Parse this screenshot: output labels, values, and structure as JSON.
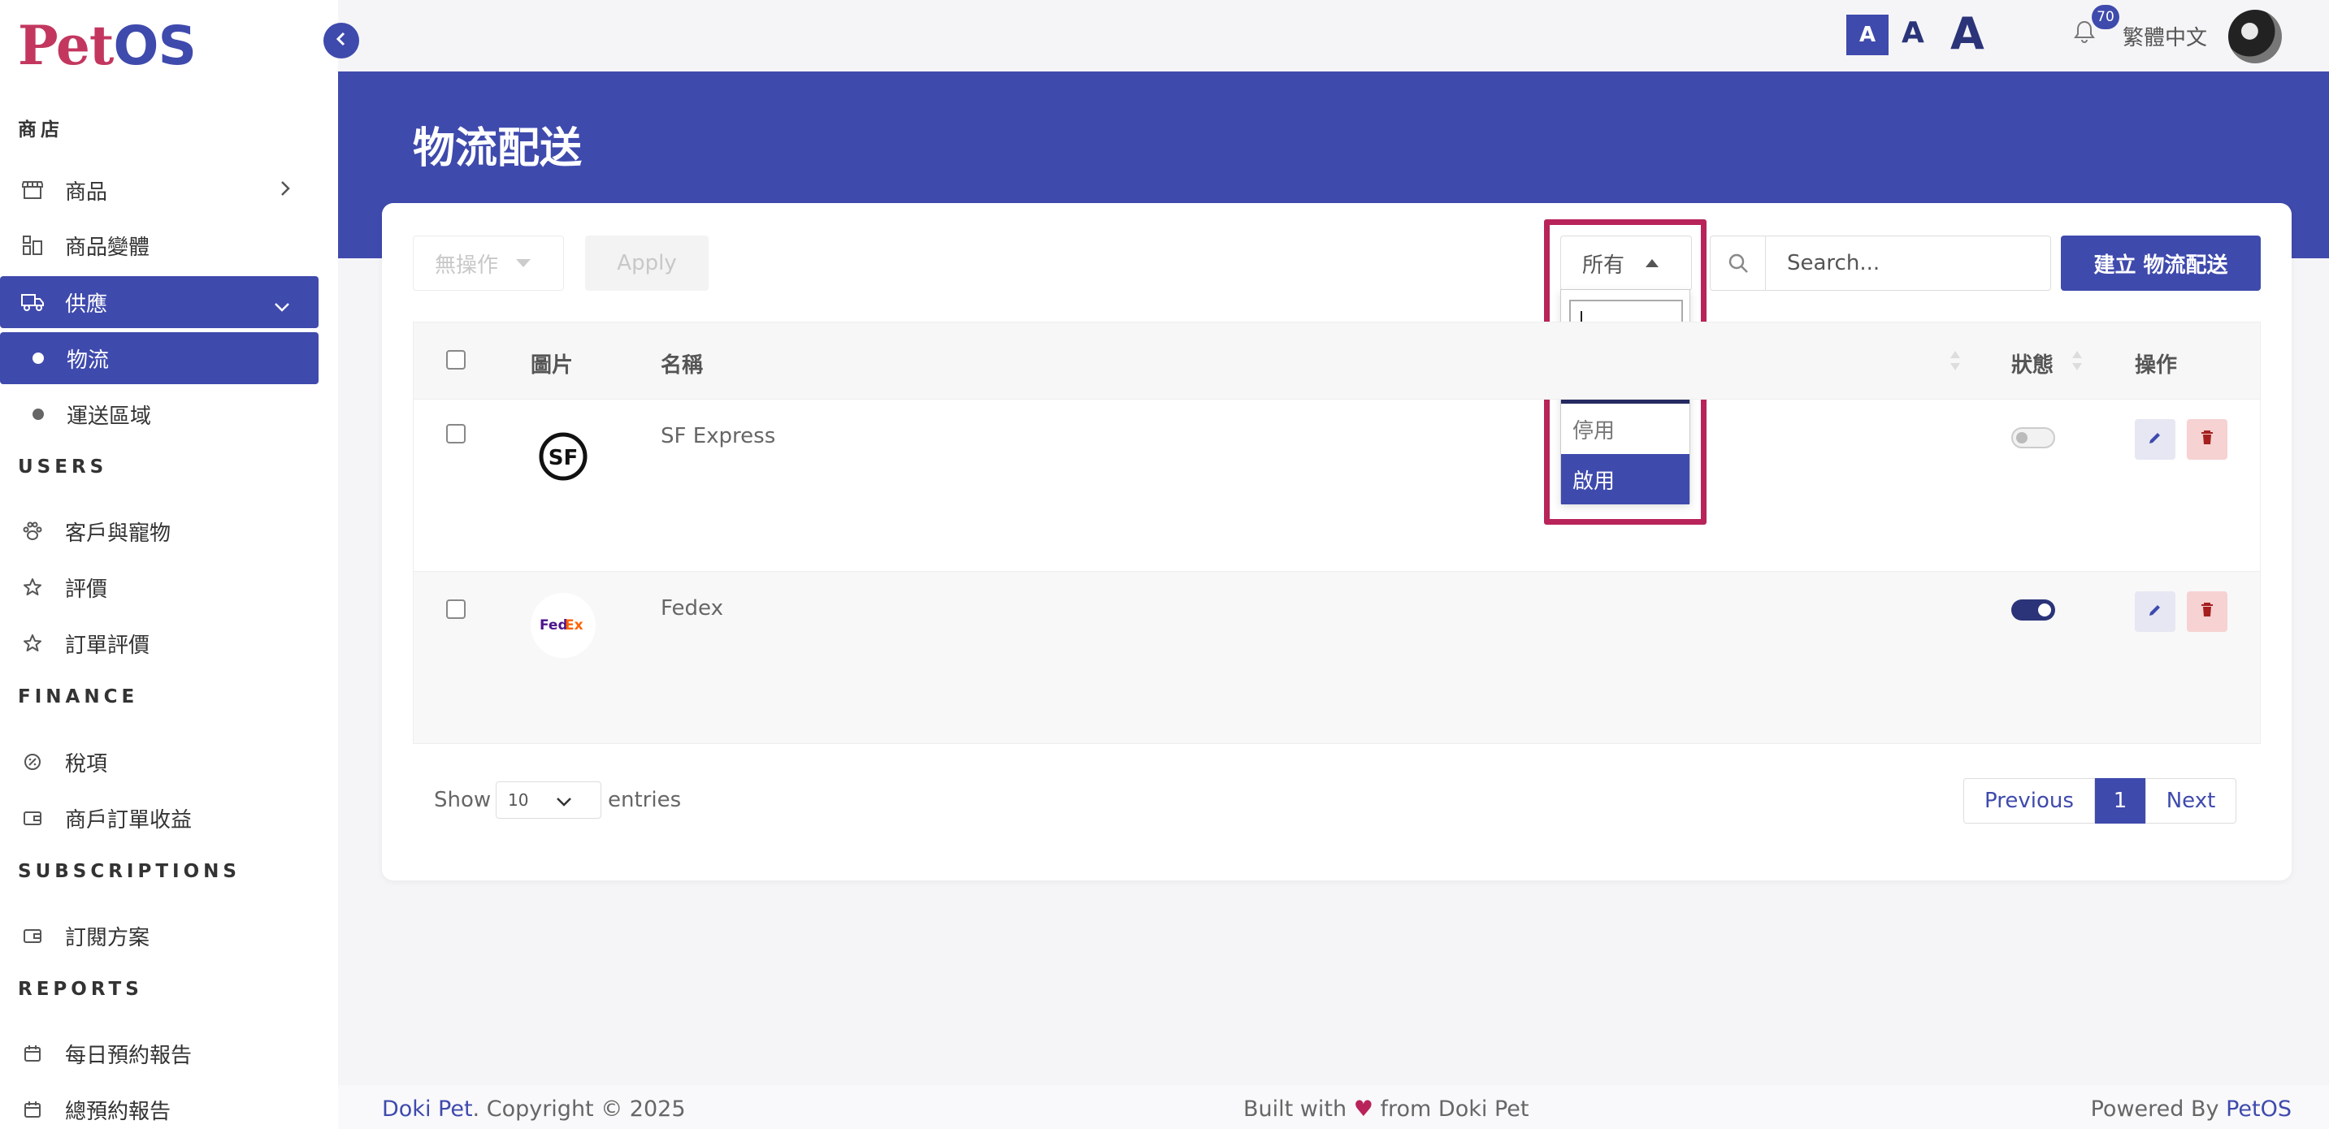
{
  "app": {
    "logo_pet": "Pet",
    "logo_os": "OS"
  },
  "sidebar": {
    "section_shop": "商店",
    "items_shop": [
      {
        "label": "商品",
        "icon": "store-icon"
      },
      {
        "label": "商品變體",
        "icon": "variant-icon"
      },
      {
        "label": "供應",
        "icon": "truck-icon"
      }
    ],
    "sub_supply": [
      {
        "label": "物流"
      },
      {
        "label": "運送區域"
      }
    ],
    "section_users": "USERS",
    "items_users": [
      {
        "label": "客戶與寵物",
        "icon": "paw-icon"
      },
      {
        "label": "評價",
        "icon": "star-icon"
      },
      {
        "label": "訂單評價",
        "icon": "star-icon"
      }
    ],
    "section_finance": "FINANCE",
    "items_finance": [
      {
        "label": "稅項",
        "icon": "tax-icon"
      },
      {
        "label": "商戶訂單收益",
        "icon": "wallet-icon"
      }
    ],
    "section_subscriptions": "SUBSCRIPTIONS",
    "items_subscriptions": [
      {
        "label": "訂閱方案",
        "icon": "wallet-icon"
      }
    ],
    "section_reports": "REPORTS",
    "items_reports": [
      {
        "label": "每日預約報告",
        "icon": "calendar-icon"
      },
      {
        "label": "總預約報告",
        "icon": "calendar-icon"
      }
    ]
  },
  "topbar": {
    "font_small": "A",
    "font_medium": "A",
    "font_large": "A",
    "notification_count": "70",
    "language": "繁體中文"
  },
  "page": {
    "title": "物流配送"
  },
  "toolbar": {
    "bulk_action": "無操作",
    "apply": "Apply",
    "filter_value": "所有",
    "search_placeholder": "Search...",
    "create": "建立 物流配送"
  },
  "filter_dropdown": {
    "options": [
      "所有",
      "停用",
      "啟用"
    ]
  },
  "table": {
    "headers": {
      "image": "圖片",
      "name": "名稱",
      "status": "狀態",
      "actions": "操作"
    },
    "rows": [
      {
        "name": "SF Express",
        "logo_text": "SF",
        "enabled": false
      },
      {
        "name": "Fedex",
        "logo_text_fed": "Fed",
        "logo_text_ex": "Ex",
        "enabled": true
      }
    ]
  },
  "pagination": {
    "show": "Show",
    "length": "10",
    "entries": "entries",
    "previous": "Previous",
    "current": "1",
    "next": "Next"
  },
  "footer": {
    "brand": "Doki Pet",
    "copyright": ". Copyright © 2025",
    "built_with": "Built with",
    "heart": "♥",
    "from": "from Doki Pet",
    "powered_by": "Powered By",
    "powered_brand": "PetOS"
  },
  "colors": {
    "primary": "#3f4aad",
    "primary_dark": "#252a61",
    "accent": "#b8245a",
    "logo_pet": "#c3375f"
  }
}
